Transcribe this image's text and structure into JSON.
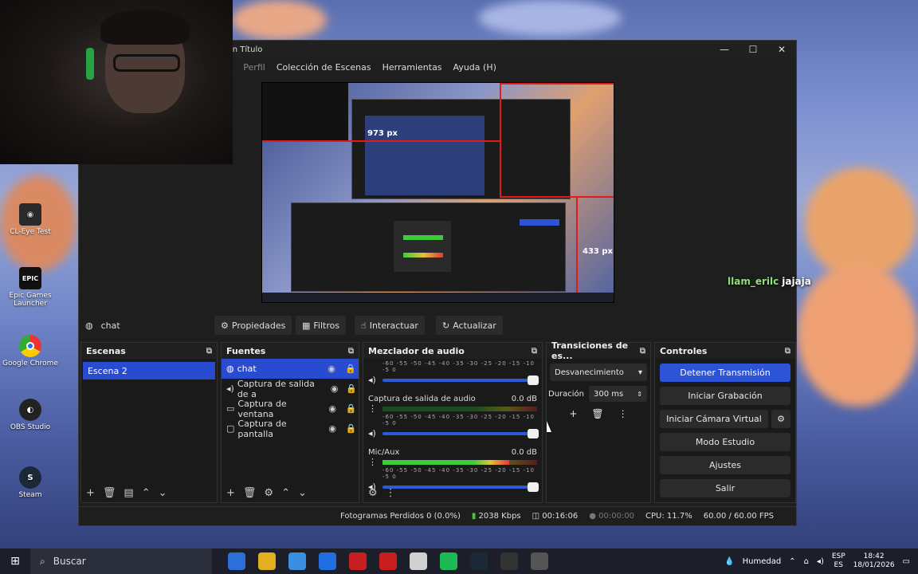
{
  "desktop": {
    "icons": [
      {
        "label": "CL-Eye Test",
        "color": "#2a2a2a",
        "glyph": "◉"
      },
      {
        "label": "Epic Games Launcher",
        "color": "#111111",
        "glyph": "EPIC"
      },
      {
        "label": "Google Chrome",
        "color": "#ffffff",
        "glyph": "●"
      },
      {
        "label": "OBS Studio",
        "color": "#222222",
        "glyph": "◐"
      },
      {
        "label": "Steam",
        "color": "#1b2838",
        "glyph": "S"
      }
    ]
  },
  "window": {
    "title": "in Título",
    "menu": [
      ")",
      "Perfil",
      "Colección de Escenas",
      "Herramientas",
      "Ayuda (H)"
    ]
  },
  "preview": {
    "measure_h": "973 px",
    "measure_v": "433 px",
    "overlay_text": "llam_erllc jajaja"
  },
  "chat": {
    "user": "llam_erilc",
    "message": "jajaja"
  },
  "source_toolbar": {
    "selected": "chat",
    "properties": "Propiedades",
    "filters": "Filtros",
    "interact": "Interactuar",
    "refresh": "Actualizar"
  },
  "scenes": {
    "title": "Escenas",
    "items": [
      "Escena 2"
    ]
  },
  "sources": {
    "title": "Fuentes",
    "items": [
      {
        "label": "chat",
        "icon": "globe-icon"
      },
      {
        "label": "Captura de salida de a",
        "icon": "speaker-icon"
      },
      {
        "label": "Captura de ventana",
        "icon": "window-icon"
      },
      {
        "label": "Captura de pantalla",
        "icon": "monitor-icon"
      }
    ]
  },
  "mixer": {
    "title": "Mezclador de audio",
    "ticks": "-60 -55 -50 -45 -40 -35 -30 -25 -20 -15 -10 -5 0",
    "channels": [
      {
        "name": "",
        "db": "",
        "level": 0
      },
      {
        "name": "Captura de salida de audio",
        "db": "0.0 dB",
        "level": 0
      },
      {
        "name": "Mic/Aux",
        "db": "0.0 dB",
        "level": 0.82
      }
    ]
  },
  "transitions": {
    "title": "Transiciones de es...",
    "type": "Desvanecimiento",
    "duration_label": "Duración",
    "duration_value": "300 ms"
  },
  "controls": {
    "title": "Controles",
    "buttons": [
      "Detener Transmisión",
      "Iniciar Grabación",
      "Iniciar Cámara Virtual",
      "Modo Estudio",
      "Ajustes",
      "Salir"
    ]
  },
  "status": {
    "dropped": "Fotogramas Perdidos 0 (0.0%)",
    "bitrate": "2038 Kbps",
    "stream_time": "00:16:06",
    "rec_time": "00:00:00",
    "cpu": "CPU: 11.7%",
    "fps": "60.00 / 60.00 FPS"
  },
  "taskbar": {
    "search_placeholder": "Buscar",
    "weather": "Humedad",
    "lang_top": "ESP",
    "lang_bottom": "ES",
    "time": "18:42",
    "date": "18/01/2026",
    "apps": [
      "#2d6fd8",
      "#e0b020",
      "#3a8fe0",
      "#1f6fe0",
      "#c82020",
      "#c81e1e",
      "#d0d0d0",
      "#1db954",
      "#1b2838",
      "#333333",
      "#555555"
    ]
  }
}
